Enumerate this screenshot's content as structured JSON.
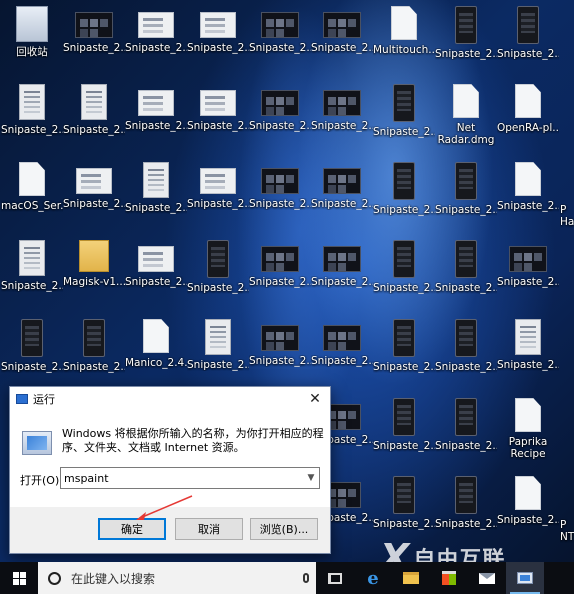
{
  "desktop": {
    "icons": [
      {
        "label": "回收站",
        "type": "bin"
      },
      {
        "label": "Snipaste_2...",
        "type": "darkwide"
      },
      {
        "label": "Snipaste_2...",
        "type": "wide"
      },
      {
        "label": "Snipaste_2...",
        "type": "wide"
      },
      {
        "label": "Snipaste_2...",
        "type": "darkwide"
      },
      {
        "label": "Snipaste_2...",
        "type": "darkwide"
      },
      {
        "label": "Multitouch...",
        "type": "doc"
      },
      {
        "label": "Snipaste_2...",
        "type": "phone"
      },
      {
        "label": "Snipaste_2...",
        "type": "phone"
      },
      {
        "label": "Snipaste_2...",
        "type": "tall"
      },
      {
        "label": "Snipaste_2...",
        "type": "tall"
      },
      {
        "label": "Snipaste_2...",
        "type": "wide"
      },
      {
        "label": "Snipaste_2...",
        "type": "wide"
      },
      {
        "label": "Snipaste_2...",
        "type": "darkwide"
      },
      {
        "label": "Snipaste_2...",
        "type": "darkwide"
      },
      {
        "label": "Snipaste_2...",
        "type": "phone"
      },
      {
        "label": "Net Radar.dmg",
        "type": "doc"
      },
      {
        "label": "OpenRA-pl...",
        "type": "doc"
      },
      {
        "label": "macOS_Ser...",
        "type": "doc"
      },
      {
        "label": "Snipaste_2...",
        "type": "wide"
      },
      {
        "label": "Snipaste_2...",
        "type": "tall"
      },
      {
        "label": "Snipaste_2...",
        "type": "wide"
      },
      {
        "label": "Snipaste_2...",
        "type": "darkwide"
      },
      {
        "label": "Snipaste_2...",
        "type": "darkwide"
      },
      {
        "label": "Snipaste_2...",
        "type": "phone"
      },
      {
        "label": "Snipaste_2...",
        "type": "phone"
      },
      {
        "label": "Snipaste_2...",
        "type": "doc"
      },
      {
        "label": "Snipaste_2...",
        "type": "tall"
      },
      {
        "label": "Magisk-v1...",
        "type": "folder"
      },
      {
        "label": "Snipaste_2...",
        "type": "wide"
      },
      {
        "label": "Snipaste_2...",
        "type": "phone"
      },
      {
        "label": "Snipaste_2...",
        "type": "darkwide"
      },
      {
        "label": "Snipaste_2...",
        "type": "darkwide"
      },
      {
        "label": "Snipaste_2...",
        "type": "phone"
      },
      {
        "label": "Snipaste_2...",
        "type": "phone"
      },
      {
        "label": "Snipaste_2...",
        "type": "darkwide"
      },
      {
        "label": "Snipaste_2...",
        "type": "phone"
      },
      {
        "label": "Snipaste_2...",
        "type": "phone"
      },
      {
        "label": "Manico_2.4...",
        "type": "doc"
      },
      {
        "label": "Snipaste_2...",
        "type": "tall"
      },
      {
        "label": "Snipaste_2...",
        "type": "darkwide"
      },
      {
        "label": "Snipaste_2...",
        "type": "darkwide"
      },
      {
        "label": "Snipaste_2...",
        "type": "phone"
      },
      {
        "label": "Snipaste_2...",
        "type": "phone"
      },
      {
        "label": "Snipaste_2...",
        "type": "tall"
      },
      {
        "label": "Snipaste_2...",
        "type": "darkwide"
      },
      {
        "label": "Snipaste_2...",
        "type": "phone"
      },
      {
        "label": "Snipaste_2...",
        "type": "phone"
      },
      {
        "label": "Paprika Recipe Ma...",
        "type": "doc"
      },
      {
        "label": "Snipaste_2...",
        "type": "darkwide"
      },
      {
        "label": "Snipaste_2...",
        "type": "phone"
      },
      {
        "label": "Snipaste_2...",
        "type": "phone"
      },
      {
        "label": "Snipaste_2...",
        "type": "doc"
      }
    ],
    "partial_labels": {
      "row3": "P",
      "row3b": "Ha",
      "row7": "P",
      "row7b": "NT"
    }
  },
  "run_dialog": {
    "title": "运行",
    "close_glyph": "✕",
    "description": "Windows 将根据你所输入的名称，为你打开相应的程序、文件夹、文档或 Internet 资源。",
    "open_label": "打开(O):",
    "open_value": "mspaint",
    "ok_label": "确定",
    "cancel_label": "取消",
    "browse_label": "浏览(B)...",
    "arrow_color": "#e53935"
  },
  "taskbar": {
    "search_placeholder": "在此键入以搜索",
    "items": [
      "task-view-icon",
      "edge-icon",
      "file-explorer-icon",
      "store-icon",
      "mail-icon",
      "run-icon"
    ]
  },
  "watermark": {
    "text": "自由互联",
    "mark": "X"
  },
  "colors": {
    "accent": "#0078d7",
    "taskbar": "#0b0d12",
    "annotation": "#e53935"
  }
}
